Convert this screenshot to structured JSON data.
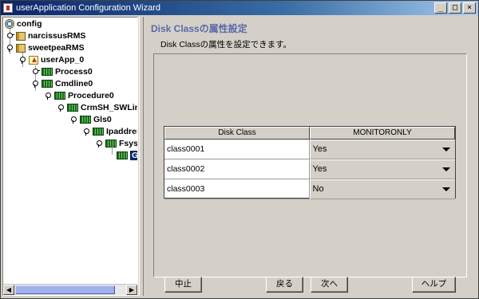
{
  "window": {
    "title": "userApplication Configuration Wizard",
    "controls": {
      "minimize": "_",
      "maximize": "□",
      "close": "×"
    }
  },
  "tree": {
    "nodes": [
      {
        "label": "config",
        "icon": "config-icon"
      },
      {
        "label": "narcissusRMS",
        "icon": "rms-node-icon",
        "handle": "collapsed"
      },
      {
        "label": "sweetpeaRMS",
        "icon": "rms-node-icon",
        "handle": "expanded"
      },
      {
        "label": "userApp_0",
        "icon": "userapp-icon",
        "handle": "expanded"
      },
      {
        "label": "Process0",
        "icon": "resource-icon",
        "handle": "collapsed"
      },
      {
        "label": "Cmdline0",
        "icon": "resource-icon",
        "handle": "expanded"
      },
      {
        "label": "Procedure0",
        "icon": "resource-icon",
        "handle": "expanded"
      },
      {
        "label": "CrmSH_SWLine",
        "icon": "resource-icon",
        "handle": "expanded"
      },
      {
        "label": "Gls0",
        "icon": "resource-icon",
        "handle": "expanded"
      },
      {
        "label": "Ipaddress",
        "icon": "resource-icon",
        "handle": "expanded"
      },
      {
        "label": "Fsyste",
        "icon": "resource-icon",
        "handle": "expanded"
      },
      {
        "label": "Gd",
        "icon": "resource-icon",
        "selected": true
      }
    ],
    "scroll_left": "◀",
    "scroll_right": "▶"
  },
  "page": {
    "title": "Disk Classの属性設定",
    "description": "Disk Classの属性を設定できます。"
  },
  "table": {
    "headers": [
      "Disk Class",
      "MONITORONLY"
    ],
    "rows": [
      {
        "disk_class": "class0001",
        "monitoronly": "Yes"
      },
      {
        "disk_class": "class0002",
        "monitoronly": "Yes"
      },
      {
        "disk_class": "class0003",
        "monitoronly": "No"
      }
    ]
  },
  "buttons": {
    "cancel": "中止",
    "back": "戻る",
    "next": "次へ",
    "help": "ヘルプ"
  },
  "colors": {
    "title_accent": "#5a6aa8",
    "selection": "#0a246a"
  }
}
